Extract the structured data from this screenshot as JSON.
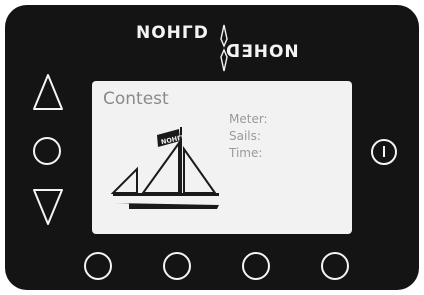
{
  "brand": {
    "top": "NOHΓD",
    "bottom": "ᗡƎHON"
  },
  "screen": {
    "title": "Contest",
    "fields": [
      {
        "label": "Meter:"
      },
      {
        "label": "Sails:"
      },
      {
        "label": "Time:"
      }
    ],
    "flag_text": "NOHΓD"
  },
  "colors": {
    "device": "#141414",
    "screen": "#f2f2f2",
    "button_stroke": "#f4f4f4",
    "screen_text": "#8a8a8a"
  }
}
